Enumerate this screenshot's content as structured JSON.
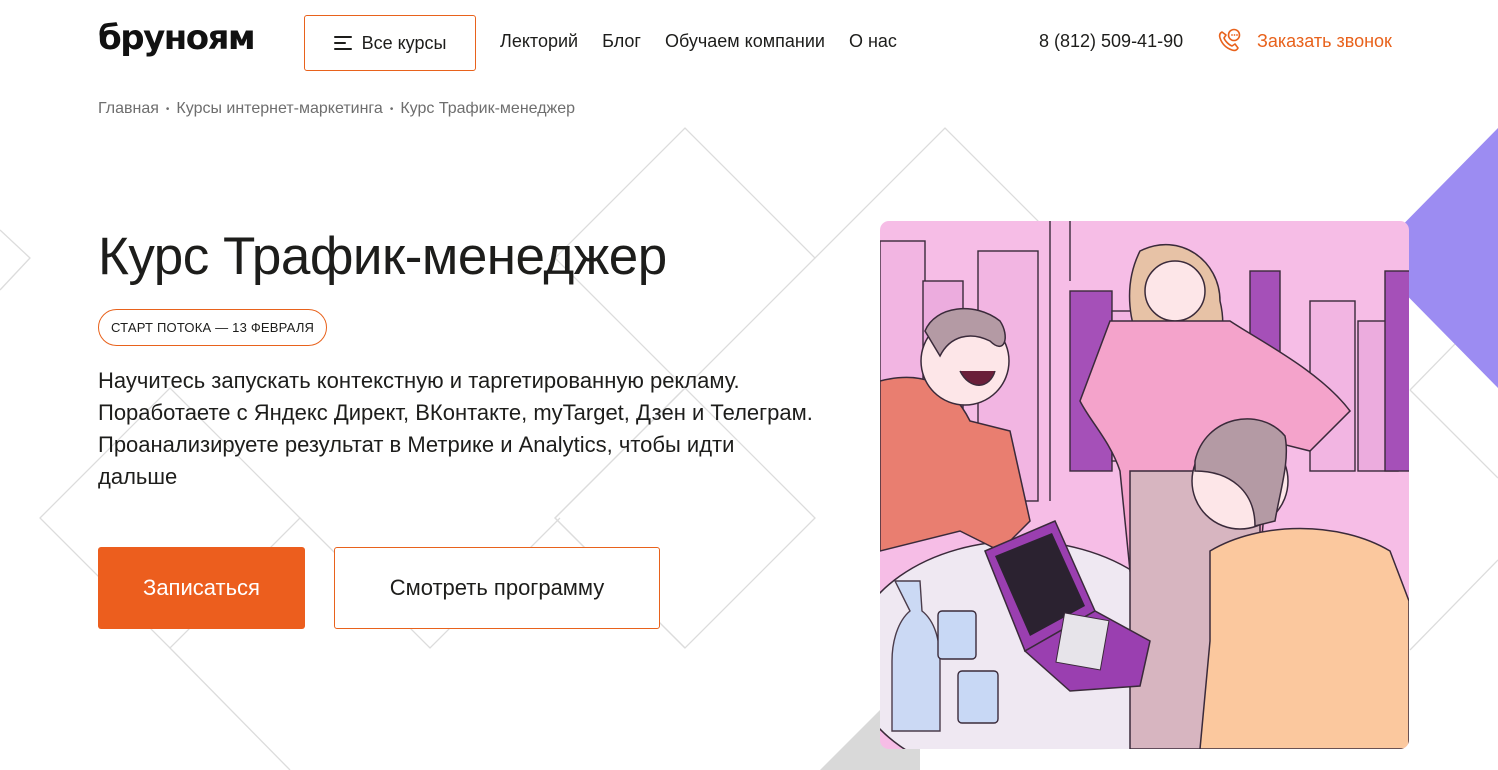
{
  "header": {
    "logo": "бруноям",
    "all_courses_label": "Все курсы",
    "nav": [
      "Лекторий",
      "Блог",
      "Обучаем компании",
      "О нас"
    ],
    "phone": "8 (812) 509-41-90",
    "callback_label": "Заказать звонок"
  },
  "breadcrumb": [
    "Главная",
    "Курсы интернет-маркетинга",
    "Курс Трафик-менеджер"
  ],
  "hero": {
    "title": "Курс Трафик-менеджер",
    "start_badge": "СТАРТ ПОТОКА — 13 ФЕВРАЛЯ",
    "description": "Научитесь запускать контекстную и таргетированную рекламу. Поработаете с Яндекс Директ, ВКонтакте, myTarget, Дзен и Телеграм. Проанализируете результат в Метрике и Analytics, чтобы идти дальше",
    "signup_label": "Записаться",
    "program_label": "Смотреть программу"
  },
  "colors": {
    "accent": "#ec5e1e",
    "accent_border": "#e8621c",
    "text": "#1d1d1b",
    "muted": "#6e6e6e",
    "illustration_bg": "#f6bde6",
    "purple": "#9c8cf2"
  },
  "icons": [
    "menu-icon",
    "phone-call-icon"
  ]
}
